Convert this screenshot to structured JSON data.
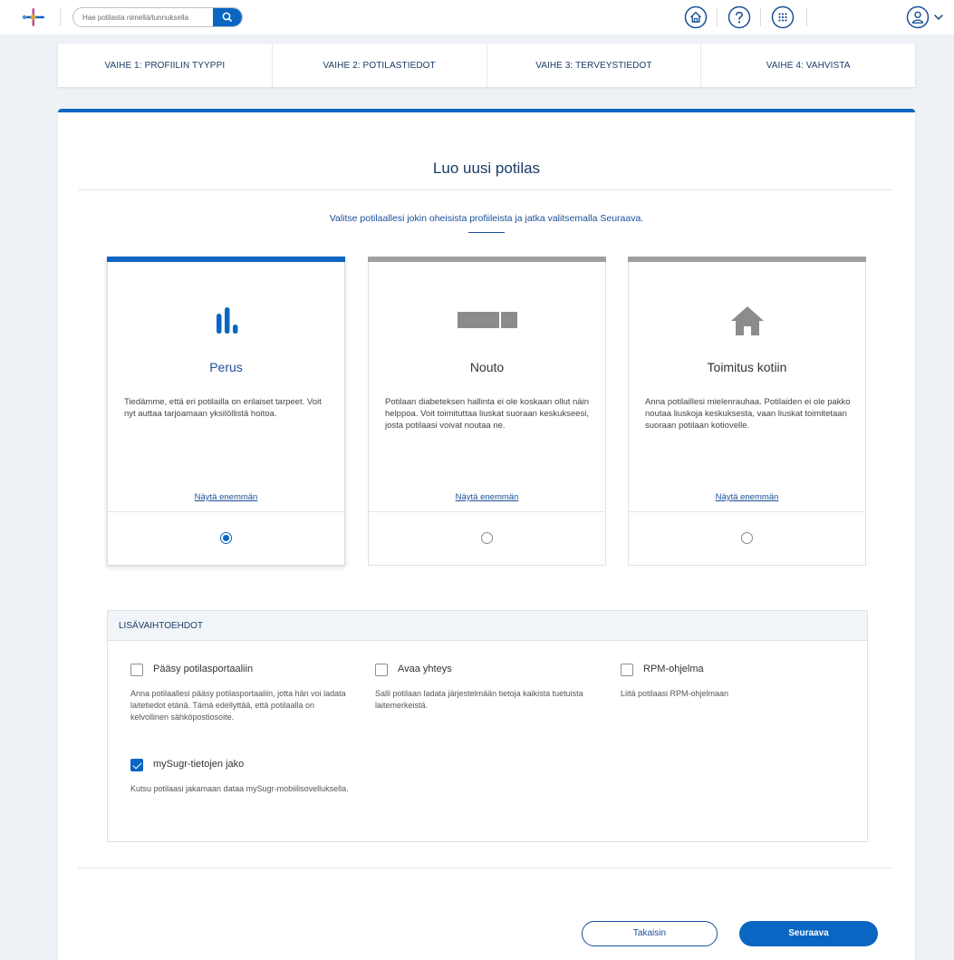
{
  "header": {
    "search_placeholder": "Hae potilasta nimellä/tunnuksella",
    "icons": [
      "app-logo-icon",
      "search-icon",
      "home-icon",
      "help-icon",
      "apps-grid-icon",
      "user-avatar-icon",
      "chevron-down-icon"
    ]
  },
  "steps": [
    {
      "label": "VAIHE 1: PROFIILIN TYYPPI"
    },
    {
      "label": "VAIHE 2: POTILASTIEDOT"
    },
    {
      "label": "VAIHE 3: TERVEYSTIEDOT"
    },
    {
      "label": "VAIHE 4: VAHVISTA"
    }
  ],
  "main": {
    "title": "Luo uusi potilas",
    "subtitle": "Valitse potilaallesi jokin oheisista profiileista ja jatka valitsemalla Seuraava."
  },
  "profiles": [
    {
      "name": "Perus",
      "icon": "bar-chart-icon",
      "description": "Tiedämme, että eri potilailla on erilaiset tarpeet. Voit nyt auttaa tarjoamaan yksilöllistä hoitoa.",
      "link": "Näytä enemmän",
      "selected": true
    },
    {
      "name": "Nouto",
      "icon": "pickup-icon",
      "description": "Potilaan diabeteksen hallinta ei ole koskaan ollut näin helppoa. Voit toimituttaa liuskat suoraan keskukseesi, josta potilaasi voivat noutaa ne.",
      "link": "Näytä enemmän",
      "selected": false
    },
    {
      "name": "Toimitus kotiin",
      "icon": "home-icon",
      "description": "Anna potilaillesi mielenrauhaa. Potilaiden ei ole pakko noutaa liuskoja keskuksesta, vaan liuskat toimitetaan suoraan potilaan kotiovelle.",
      "link": "Näytä enemmän",
      "selected": false
    }
  ],
  "options": {
    "title": "LISÄVAIHTOEHDOT",
    "items": [
      {
        "label": "Pääsy potilasportaaliin",
        "description": "Anna potilaallesi pääsy potilasportaaliin, jotta hän voi ladata laitetiedot etänä. Tämä edellyttää, että potilaalla on kelvollinen sähköpostiosoite.",
        "checked": false
      },
      {
        "label": "Avaa yhteys",
        "description": "Salli potilaan ladata järjestelmään tietoja kaikista tuetuista laitemerkeistä.",
        "checked": false
      },
      {
        "label": "RPM-ohjelma",
        "description": "Liitä potilaasi RPM-ohjelmaan",
        "checked": false
      },
      {
        "label": "mySugr-tietojen jako",
        "description": "Kutsu potilaasi jakamaan dataa mySugr-mobiilisovelluksella.",
        "checked": true
      }
    ]
  },
  "footer": {
    "back_label": "Takaisin",
    "next_label": "Seuraava"
  },
  "colors": {
    "primary": "#0a66c2",
    "navy_text": "#1a3b66",
    "inactive_bar": "#a0a0a0",
    "background": "#eef1f5"
  }
}
